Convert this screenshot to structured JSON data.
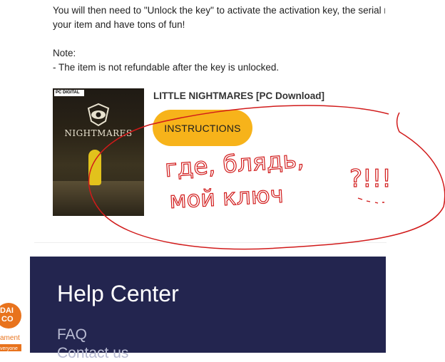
{
  "intro": {
    "line1": "You will then need to \"Unlock the key\" to activate the activation key, the serial r",
    "line2": "your item and have tons of fun!"
  },
  "note": {
    "label": "Note:",
    "text": "- The item is not refundable after the key is unlocked."
  },
  "product": {
    "cover_badge": "PC DIGITAL",
    "cover_title": "NIGHTMARES",
    "title": "LITTLE NIGHTMARES [PC Download]",
    "button_label": "INSTRUCTIONS"
  },
  "help": {
    "title": "Help Center",
    "links": [
      "FAQ",
      "Contact us"
    ]
  },
  "logo": {
    "line1": "DAI",
    "line2": "CO",
    "line3": "ament",
    "line4": "veryone"
  },
  "handwriting": {
    "line1": "где, блядь,",
    "line2": "мой ключ",
    "mark": "?!!!"
  },
  "colors": {
    "accent_button": "#f7b31a",
    "help_panel": "#23254f",
    "scribble": "#d11a1a"
  }
}
